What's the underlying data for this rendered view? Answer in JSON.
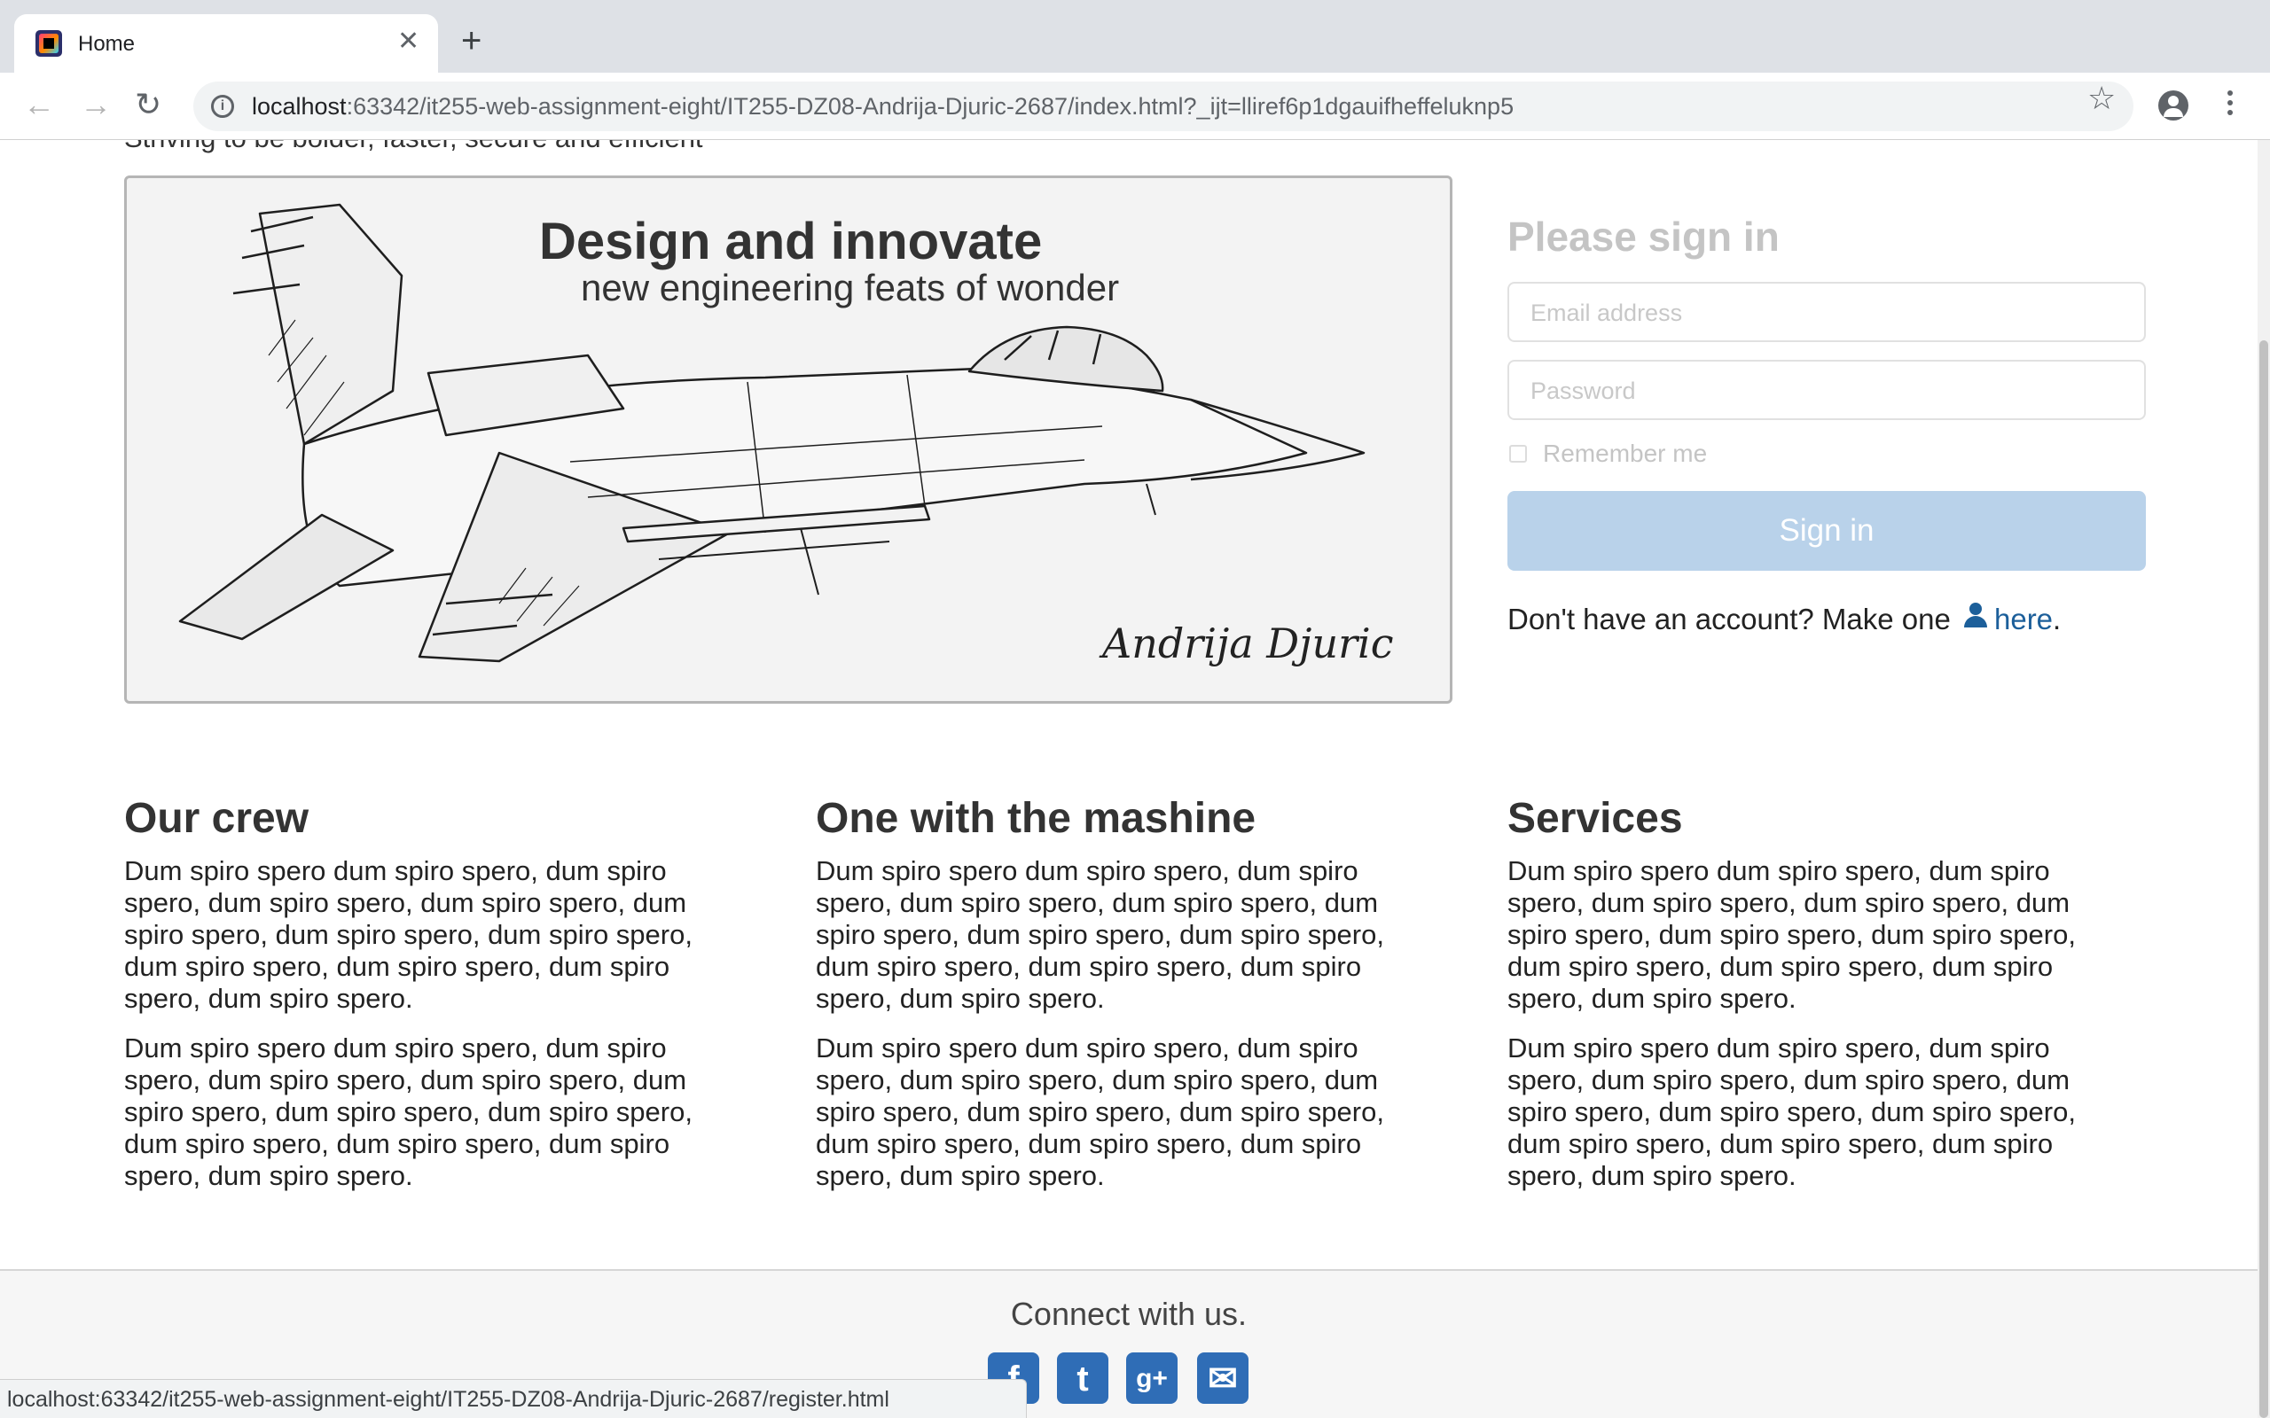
{
  "browser": {
    "tab_title": "Home",
    "tab_close": "✕",
    "new_tab": "+",
    "back": "←",
    "forward": "→",
    "reload": "↻",
    "url_host": "localhost",
    "url_rest": ":63342/it255-web-assignment-eight/IT255-DZ08-Andrija-Djuric-2687/index.html?_ijt=lliref6p1dgauifheffeluknp5",
    "bookmark_star": "☆",
    "status_url": "localhost:63342/it255-web-assignment-eight/IT255-DZ08-Andrija-Djuric-2687/register.html"
  },
  "page": {
    "tagline": "Striving to be bolder, faster, secure and efficient",
    "hero": {
      "title": "Design and innovate",
      "subtitle": "new engineering feats of wonder",
      "signature": "Andrija Djuric"
    },
    "signin": {
      "heading": "Please sign in",
      "email_placeholder": "Email address",
      "password_placeholder": "Password",
      "remember_label": "Remember me",
      "button": "Sign in",
      "register_prefix": "Don't have an account? Make one",
      "register_link": "here",
      "register_suffix": "."
    },
    "columns": [
      {
        "heading": "Our crew",
        "p1": "Dum spiro spero dum spiro spero, dum spiro spero, dum spiro spero, dum spiro spero, dum spiro spero, dum spiro spero, dum spiro spero, dum spiro spero, dum spiro spero, dum spiro spero, dum spiro spero.",
        "p2": "Dum spiro spero dum spiro spero, dum spiro spero, dum spiro spero, dum spiro spero, dum spiro spero, dum spiro spero, dum spiro spero, dum spiro spero, dum spiro spero, dum spiro spero, dum spiro spero."
      },
      {
        "heading": "One with the mashine",
        "p1": "Dum spiro spero dum spiro spero, dum spiro spero, dum spiro spero, dum spiro spero, dum spiro spero, dum spiro spero, dum spiro spero, dum spiro spero, dum spiro spero, dum spiro spero, dum spiro spero.",
        "p2": "Dum spiro spero dum spiro spero, dum spiro spero, dum spiro spero, dum spiro spero, dum spiro spero, dum spiro spero, dum spiro spero, dum spiro spero, dum spiro spero, dum spiro spero, dum spiro spero."
      },
      {
        "heading": "Services",
        "p1": "Dum spiro spero dum spiro spero, dum spiro spero, dum spiro spero, dum spiro spero, dum spiro spero, dum spiro spero, dum spiro spero, dum spiro spero, dum spiro spero, dum spiro spero, dum spiro spero.",
        "p2": "Dum spiro spero dum spiro spero, dum spiro spero, dum spiro spero, dum spiro spero, dum spiro spero, dum spiro spero, dum spiro spero, dum spiro spero, dum spiro spero, dum spiro spero, dum spiro spero."
      }
    ],
    "footer": {
      "text": "Connect with us.",
      "icons": {
        "facebook": "f",
        "twitter": "t",
        "googleplus": "g+",
        "mail": "✉"
      }
    }
  },
  "colors": {
    "accent": "#1c5f9a",
    "signin_button": "#b9d2ea",
    "social": "#2f6db6"
  }
}
